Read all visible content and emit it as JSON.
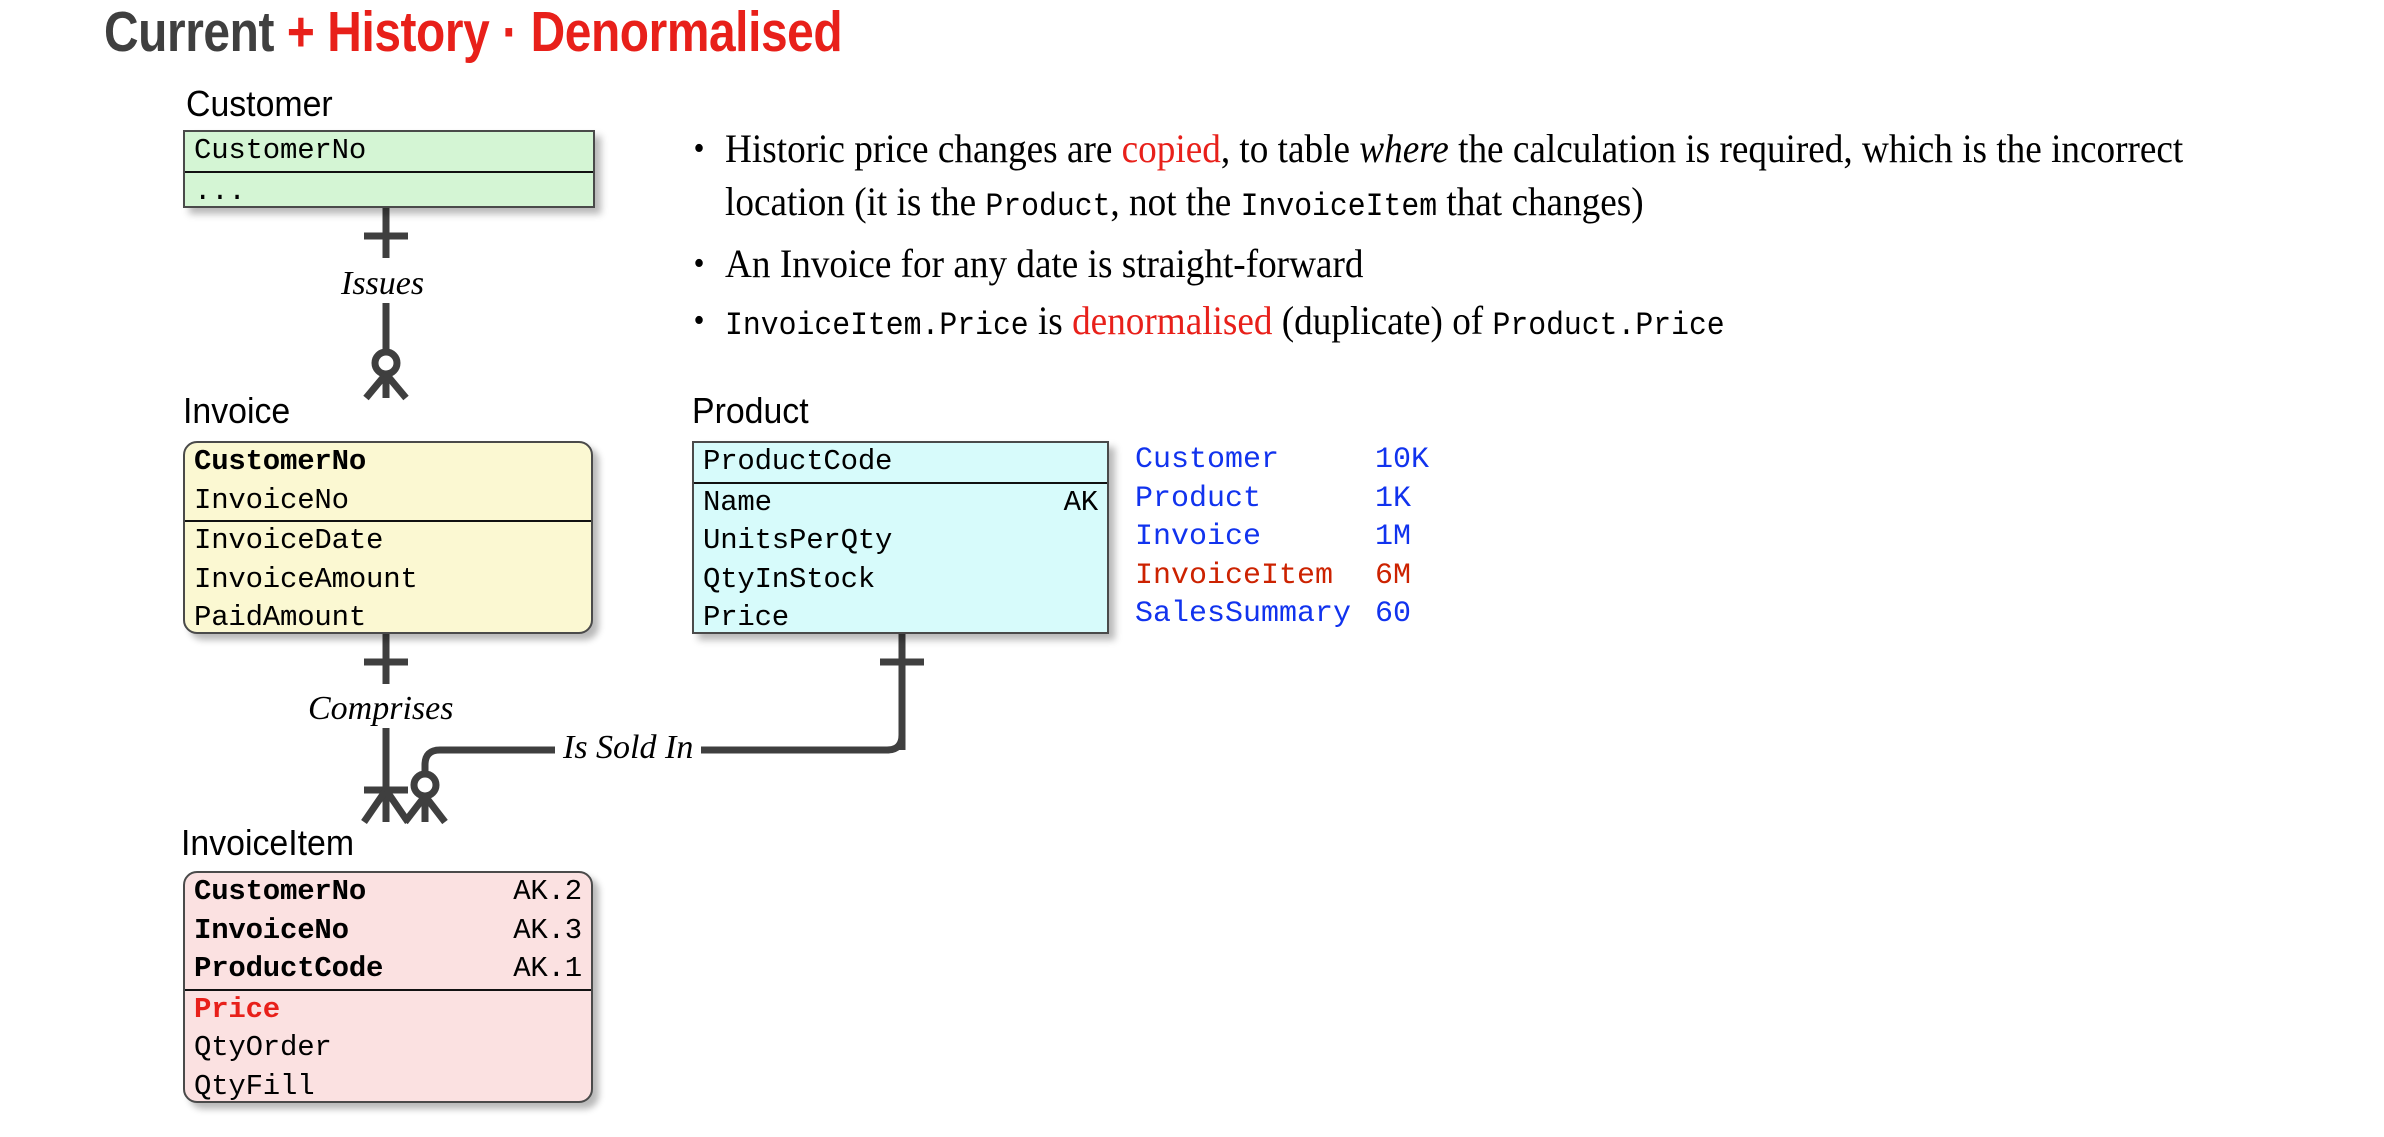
{
  "title": {
    "part1": "Current ",
    "part2": "+ History · Denormalised"
  },
  "entities": [
    {
      "key": "customer",
      "label": "Customer",
      "upper": [
        {
          "name": "CustomerNo",
          "tag": "",
          "style": "plain"
        }
      ],
      "lower": [
        {
          "name": "...",
          "tag": "",
          "style": "plain"
        }
      ]
    },
    {
      "key": "invoice",
      "label": "Invoice",
      "upper": [
        {
          "name": "CustomerNo",
          "tag": "",
          "style": "bold"
        },
        {
          "name": "InvoiceNo",
          "tag": "",
          "style": "plain"
        }
      ],
      "lower": [
        {
          "name": "InvoiceDate",
          "tag": "",
          "style": "plain"
        },
        {
          "name": "InvoiceAmount",
          "tag": "",
          "style": "plain"
        },
        {
          "name": "PaidAmount",
          "tag": "",
          "style": "plain"
        }
      ]
    },
    {
      "key": "product",
      "label": "Product",
      "upper": [
        {
          "name": "ProductCode",
          "tag": "",
          "style": "plain"
        }
      ],
      "lower": [
        {
          "name": "Name",
          "tag": "AK",
          "style": "plain"
        },
        {
          "name": "UnitsPerQty",
          "tag": "",
          "style": "plain"
        },
        {
          "name": "QtyInStock",
          "tag": "",
          "style": "plain"
        },
        {
          "name": "Price",
          "tag": "",
          "style": "plain"
        }
      ]
    },
    {
      "key": "invoiceitem",
      "label": "InvoiceItem",
      "upper": [
        {
          "name": "CustomerNo",
          "tag": "AK.2",
          "style": "bold"
        },
        {
          "name": "InvoiceNo",
          "tag": "AK.3",
          "style": "bold"
        },
        {
          "name": "ProductCode",
          "tag": "AK.1",
          "style": "bold"
        }
      ],
      "lower": [
        {
          "name": "Price",
          "tag": "",
          "style": "red"
        },
        {
          "name": "QtyOrder",
          "tag": "",
          "style": "plain"
        },
        {
          "name": "QtyFill",
          "tag": "",
          "style": "plain"
        }
      ]
    }
  ],
  "relationships": [
    {
      "key": "issues",
      "label": "Issues"
    },
    {
      "key": "comprises",
      "label": "Comprises"
    },
    {
      "key": "is-sold-in",
      "label": "Is Sold In"
    }
  ],
  "bullets": [
    {
      "id": "bullet-1",
      "marker": "•",
      "runs": [
        {
          "t": "Historic price changes are ",
          "s": "plain"
        },
        {
          "t": "copied",
          "s": "red"
        },
        {
          "t": ", to table ",
          "s": "plain"
        },
        {
          "t": "where",
          "s": "italic"
        },
        {
          "t": " the calculation is required, which is the incorrect location (it is the ",
          "s": "plain"
        },
        {
          "t": "Product",
          "s": "mono"
        },
        {
          "t": ", not the ",
          "s": "plain"
        },
        {
          "t": "InvoiceItem",
          "s": "mono"
        },
        {
          "t": " that changes)",
          "s": "plain"
        }
      ]
    },
    {
      "id": "bullet-2",
      "marker": "•",
      "runs": [
        {
          "t": "An Invoice for any date is straight-forward",
          "s": "plain"
        }
      ]
    },
    {
      "id": "bullet-3",
      "marker": "•",
      "runs": [
        {
          "t": "InvoiceItem.Price",
          "s": "mono"
        },
        {
          "t": " is ",
          "s": "plain"
        },
        {
          "t": "denormalised",
          "s": "red"
        },
        {
          "t": " (duplicate) of ",
          "s": "plain"
        },
        {
          "t": "Product.Price",
          "s": "mono"
        }
      ]
    }
  ],
  "stats": {
    "rows": [
      {
        "name": "Customer",
        "value": "10K",
        "color": "blue"
      },
      {
        "name": "Product",
        "value": "1K",
        "color": "blue"
      },
      {
        "name": "Invoice",
        "value": "1M",
        "color": "blue"
      },
      {
        "name": "InvoiceItem",
        "value": "6M",
        "color": "red"
      },
      {
        "name": "SalesSummary",
        "value": "60",
        "color": "blue"
      }
    ]
  },
  "colors": {
    "title_dark": "#3f3f3f",
    "accent_red": "#e8201a",
    "customer_fill": "#d4f5d4",
    "invoice_fill": "#fbf8d2",
    "product_fill": "#d7fbfb",
    "invoiceitem_fill": "#fbe1e1",
    "stats_blue": "#1133ee",
    "stats_red": "#cc2200",
    "line": "#3f3f3f"
  }
}
